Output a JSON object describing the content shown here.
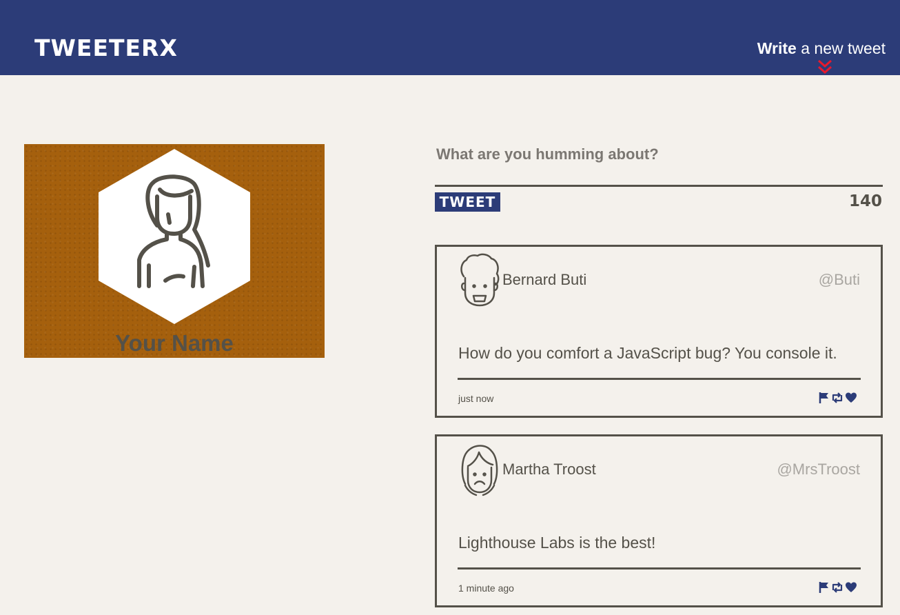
{
  "nav": {
    "brand": "TWEETERX",
    "write_bold": "Write",
    "write_rest": " a new tweet",
    "accent_color": "#e8192c"
  },
  "profile": {
    "name": "Your Name",
    "background_color": "#a5600d"
  },
  "composer": {
    "label": "What are you humming about?",
    "button_label": "TWEET",
    "counter": "140"
  },
  "tweets": [
    {
      "name": "Bernard Buti",
      "handle": "@Buti",
      "content": "How do you comfort a JavaScript bug? You console it.",
      "time": "just now",
      "actions": [
        "flag-icon",
        "retweet-icon",
        "heart-icon"
      ]
    },
    {
      "name": "Martha Troost",
      "handle": "@MrsTroost",
      "content": "Lighthouse Labs is the best!",
      "time": "1 minute ago",
      "actions": [
        "flag-icon",
        "retweet-icon",
        "heart-icon"
      ]
    }
  ],
  "colors": {
    "navbar": "#2c3c78",
    "page_background": "#f4f1ec",
    "text": "#545149",
    "muted": "#a9a6a1"
  }
}
